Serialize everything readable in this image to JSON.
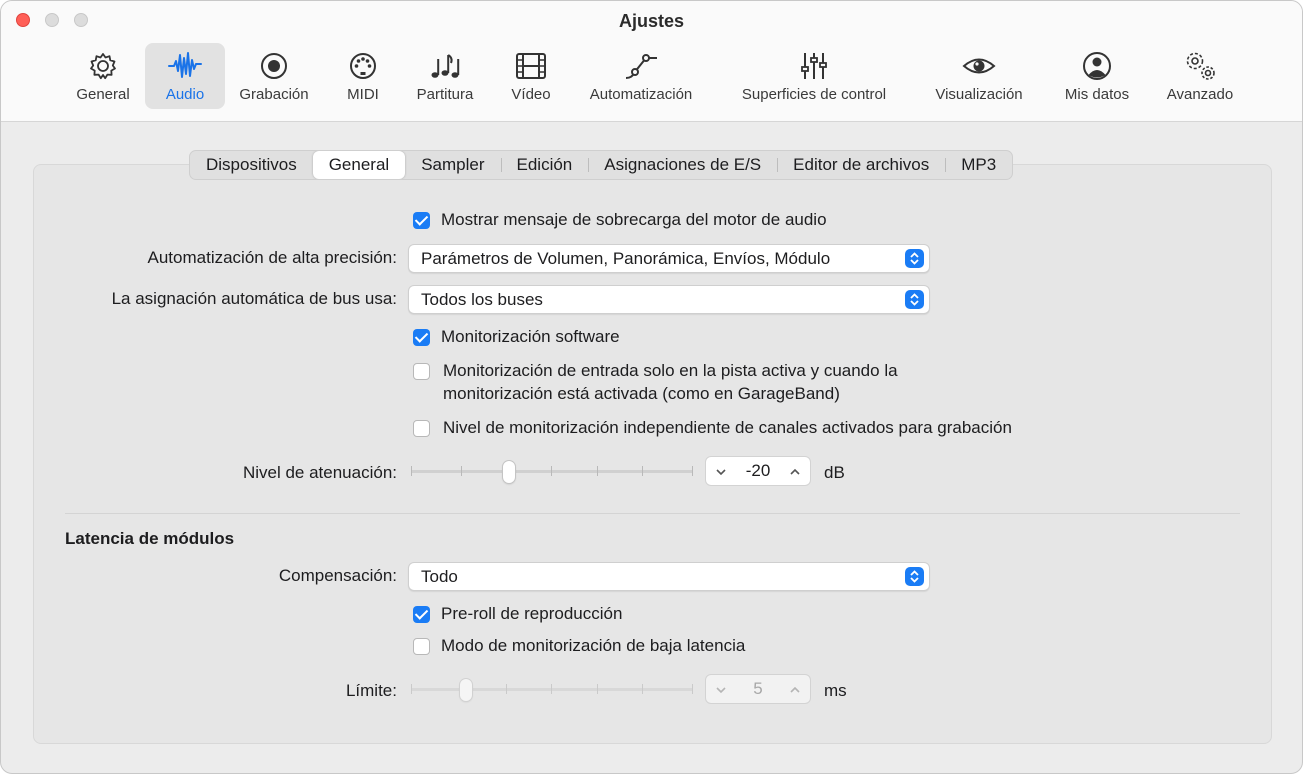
{
  "window": {
    "title": "Ajustes"
  },
  "toolbar": {
    "items": [
      {
        "label": "General",
        "icon": "gear-icon"
      },
      {
        "label": "Audio",
        "icon": "waveform-icon",
        "active": true
      },
      {
        "label": "Grabación",
        "icon": "record-icon"
      },
      {
        "label": "MIDI",
        "icon": "midi-port-icon"
      },
      {
        "label": "Partitura",
        "icon": "music-notes-icon"
      },
      {
        "label": "Vídeo",
        "icon": "film-icon"
      },
      {
        "label": "Automatización",
        "icon": "automation-curve-icon"
      },
      {
        "label": "Superficies de control",
        "icon": "faders-icon"
      },
      {
        "label": "Visualización",
        "icon": "eye-icon"
      },
      {
        "label": "Mis datos",
        "icon": "person-icon"
      },
      {
        "label": "Avanzado",
        "icon": "gears-icon"
      }
    ]
  },
  "tabs": [
    "Dispositivos",
    "General",
    "Sampler",
    "Edición",
    "Asignaciones de E/S",
    "Editor de archivos",
    "MP3"
  ],
  "selected_tab": "General",
  "settings": {
    "overload_message": {
      "label": "Mostrar mensaje de sobrecarga del motor de audio",
      "checked": true
    },
    "high_precision_automation": {
      "label": "Automatización de alta precisión:",
      "value": "Parámetros de Volumen, Panorámica, Envíos, Módulo"
    },
    "auto_bus_assignment": {
      "label": "La asignación automática de bus usa:",
      "value": "Todos los buses"
    },
    "software_monitoring": {
      "label": "Monitorización software",
      "checked": true
    },
    "input_monitoring_active_track": {
      "label_line1": "Monitorización de entrada solo en la pista activa y cuando la",
      "label_line2": "monitorización está activada (como en GarageBand)",
      "checked": false
    },
    "independent_monitoring_level": {
      "label": "Nivel de monitorización independiente de canales activados para grabación",
      "checked": false
    },
    "dim_level": {
      "label": "Nivel de atenuación:",
      "value": "-20",
      "unit": "dB",
      "fraction": 0.34
    }
  },
  "plugin_latency": {
    "title": "Latencia de módulos",
    "compensation": {
      "label": "Compensación:",
      "value": "Todo"
    },
    "playback_preroll": {
      "label": "Pre-roll de reproducción",
      "checked": true
    },
    "low_latency_mode": {
      "label": "Modo de monitorización de baja latencia",
      "checked": false
    },
    "limit": {
      "label": "Límite:",
      "value": "5",
      "unit": "ms",
      "fraction": 0.18,
      "enabled": false
    }
  },
  "colors": {
    "accent": "#1a7cf5",
    "close": "#ff5f57"
  }
}
